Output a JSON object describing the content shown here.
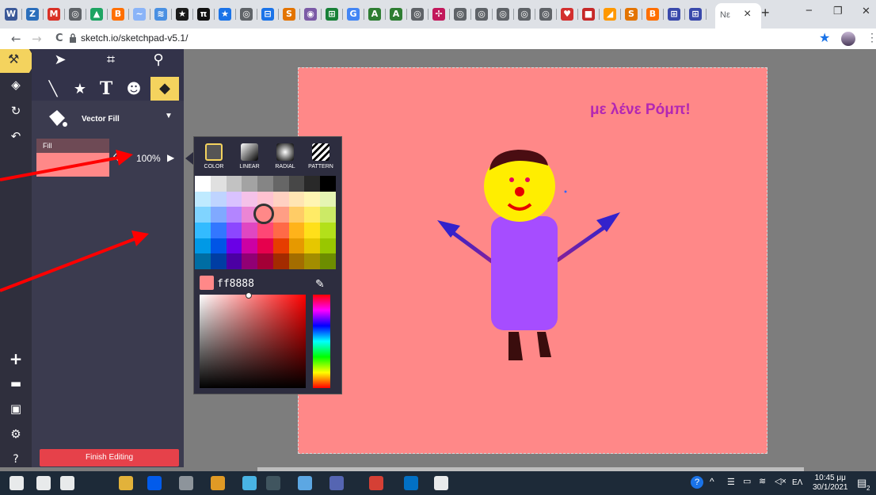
{
  "browser": {
    "url": "sketch.io/sketchpad-v5.1/",
    "active_tab_title": "Νε",
    "close_tab": "×",
    "new_tab": "+",
    "window_controls": [
      "−",
      "❐",
      "✕"
    ],
    "nav": {
      "back": "←",
      "forward": "→",
      "reload": "C"
    },
    "toolbar_icons": [
      "star-icon",
      "profile-icon",
      "menu-icon"
    ],
    "favicons": [
      {
        "icon": "W",
        "color": "#3b5998"
      },
      {
        "icon": "Z",
        "color": "#2a6ebb"
      },
      {
        "icon": "M",
        "color": "#d93025"
      },
      {
        "icon": "◎",
        "color": "#5f6368"
      },
      {
        "icon": "▲",
        "color": "#1da462"
      },
      {
        "icon": "B",
        "color": "#ff6f00"
      },
      {
        "icon": "~",
        "color": "#8ab4f8"
      },
      {
        "icon": "≋",
        "color": "#4a90e2"
      },
      {
        "icon": "★",
        "color": "#1a1a1a"
      },
      {
        "icon": "π",
        "color": "#111"
      },
      {
        "icon": "★",
        "color": "#1a73e8"
      },
      {
        "icon": "◎",
        "color": "#5f6368"
      },
      {
        "icon": "⊟",
        "color": "#1a73e8"
      },
      {
        "icon": "S",
        "color": "#e37400"
      },
      {
        "icon": "◉",
        "color": "#7b5aa6"
      },
      {
        "icon": "⊞",
        "color": "#188038"
      },
      {
        "icon": "G",
        "color": "#4285f4"
      },
      {
        "icon": "A",
        "color": "#2e7d32"
      },
      {
        "icon": "A",
        "color": "#2e7d32"
      },
      {
        "icon": "◎",
        "color": "#5f6368"
      },
      {
        "icon": "✢",
        "color": "#c2185b"
      },
      {
        "icon": "◎",
        "color": "#5f6368"
      },
      {
        "icon": "◎",
        "color": "#5f6368"
      },
      {
        "icon": "◎",
        "color": "#5f6368"
      },
      {
        "icon": "◎",
        "color": "#5f6368"
      },
      {
        "icon": "◎",
        "color": "#5f6368"
      },
      {
        "icon": "♥",
        "color": "#d32f2f"
      },
      {
        "icon": "■",
        "color": "#c62828"
      },
      {
        "icon": "◢",
        "color": "#ff9800"
      },
      {
        "icon": "S",
        "color": "#e37400"
      },
      {
        "icon": "B",
        "color": "#ff6f00"
      },
      {
        "icon": "⊞",
        "color": "#3949ab"
      },
      {
        "icon": "⊞",
        "color": "#3949ab"
      }
    ]
  },
  "sidebar": {
    "rail_icons": [
      "tools-icon",
      "layers-icon",
      "history-icon",
      "undo-icon"
    ],
    "rail_bottom_icons": [
      "plus-icon",
      "folder-icon",
      "save-icon",
      "settings-icon",
      "help-icon"
    ],
    "tools_row1": [
      "pointer-icon",
      "crop-icon",
      "zoom-icon"
    ],
    "tools_row2": [
      "line-icon",
      "star-icon",
      "text-icon",
      "emoji-icon",
      "fill-bucket-icon"
    ],
    "fill_mode": "Vector Fill",
    "fill_label": "Fill",
    "fill_color": "#ff8888",
    "opacity": "100%",
    "finish_button": "Finish Editing"
  },
  "color_popup": {
    "tabs": [
      "COLOR",
      "LINEAR",
      "RADIAL",
      "PATTERN"
    ],
    "hex_value": "ff8888",
    "palette": [
      [
        "#ffffff",
        "#e0e0e0",
        "#c2c2c2",
        "#a3a3a3",
        "#858585",
        "#666666",
        "#474747",
        "#292929",
        "#000000"
      ],
      [
        "#bfeaff",
        "#bfd4ff",
        "#d9c2ff",
        "#f5c2e9",
        "#ffc2d1",
        "#ffd1c2",
        "#ffe5b3",
        "#fff5b3",
        "#e5f5b3"
      ],
      [
        "#80d4ff",
        "#80a9ff",
        "#b385ff",
        "#eb85d4",
        "#ff85a3",
        "#ff9e85",
        "#ffcc66",
        "#ffeb66",
        "#ccea66"
      ],
      [
        "#33bbff",
        "#3377ff",
        "#8c47ff",
        "#e047c2",
        "#ff4775",
        "#ff6a47",
        "#ffb31a",
        "#ffe01a",
        "#b3e01a"
      ],
      [
        "#0099e6",
        "#0055e6",
        "#6a00e6",
        "#cc00a3",
        "#e6004d",
        "#e63d00",
        "#e69900",
        "#e6c700",
        "#99c700"
      ],
      [
        "#006da3",
        "#003da3",
        "#4b00a3",
        "#910074",
        "#a30036",
        "#a32b00",
        "#a36d00",
        "#a38d00",
        "#6d8d00"
      ]
    ]
  },
  "drawing": {
    "title_text": "με λένε Ρόμπ!",
    "background": "#ff8888"
  },
  "taskbar": {
    "apps": [
      {
        "icon": "windows-start-icon",
        "color": "#ffffff"
      },
      {
        "icon": "search-icon",
        "color": "#ffffff"
      },
      {
        "icon": "cortana-icon",
        "color": "#ffffff"
      },
      {
        "icon": "file-explorer-icon",
        "color": "#f8c13b"
      },
      {
        "icon": "dropbox-icon",
        "color": "#0061ff"
      },
      {
        "icon": "app-icon",
        "color": "#9aa0a6"
      },
      {
        "icon": "app-icon",
        "color": "#f6a623"
      },
      {
        "icon": "app-icon",
        "color": "#4fc3f7"
      },
      {
        "icon": "calculator-icon",
        "color": "#455a64"
      },
      {
        "icon": "app-icon",
        "color": "#64b5f6"
      },
      {
        "icon": "app-icon",
        "color": "#5c6bc0"
      },
      {
        "icon": "chrome-icon",
        "color": "#ea4335"
      },
      {
        "icon": "mail-icon",
        "color": "#0078d4"
      },
      {
        "icon": "shield-icon",
        "color": "#ffffff"
      }
    ],
    "lang": "ΕΛ",
    "time": "10:45 μμ",
    "date": "30/1/2021",
    "notif_count": "2"
  }
}
